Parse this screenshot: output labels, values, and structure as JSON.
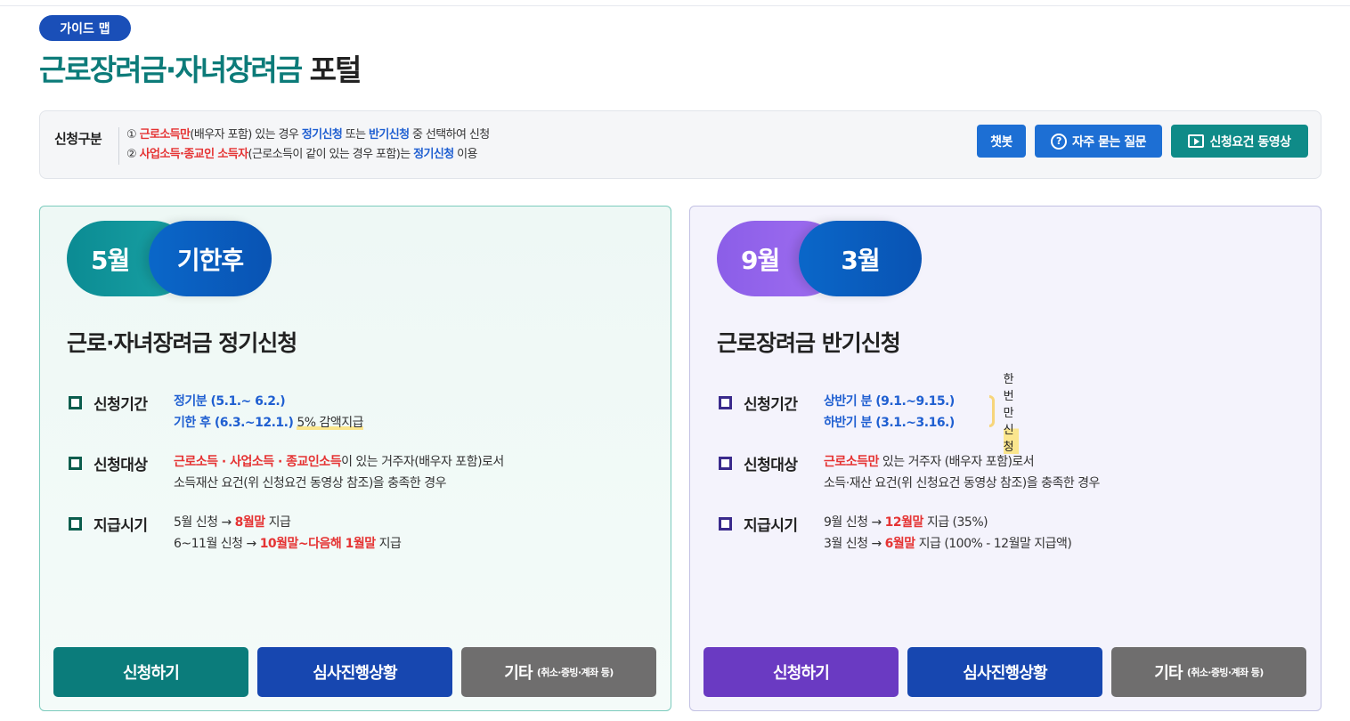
{
  "header": {
    "badge": "가이드 맵",
    "title_main": "근로장려금·자녀장려금",
    "title_sub": "포털"
  },
  "notice": {
    "label": "신청구분",
    "line1": [
      {
        "t": "① ",
        "s": ""
      },
      {
        "t": "근로소득만",
        "s": "red"
      },
      {
        "t": "(배우자 포함) 있는 경우 ",
        "s": ""
      },
      {
        "t": "정기신청",
        "s": "blue"
      },
      {
        "t": " 또는 ",
        "s": ""
      },
      {
        "t": "반기신청",
        "s": "blue"
      },
      {
        "t": " 중 선택하여 신청",
        "s": ""
      }
    ],
    "line2": [
      {
        "t": "② ",
        "s": ""
      },
      {
        "t": "사업소득·종교인 소득자",
        "s": "red"
      },
      {
        "t": "(근로소득이 같이 있는 경우 포함)는 ",
        "s": ""
      },
      {
        "t": "정기신청",
        "s": "blue"
      },
      {
        "t": " 이용",
        "s": ""
      }
    ],
    "buttons": {
      "chatbot": "챗봇",
      "faq": "자주 묻는 질문",
      "video": "신청요건 동영상"
    }
  },
  "cards": [
    {
      "pill_a": "5월",
      "pill_b": "기한후",
      "title": "근로·자녀장려금 정기신청",
      "rows": [
        {
          "label": "신청기간",
          "lines": [
            [
              {
                "t": "정기분 (5.1.~ 6.2.)",
                "s": "blue"
              }
            ],
            [
              {
                "t": "기한 후 (6.3.~12.1.)",
                "s": "blue"
              },
              {
                "t": "  ",
                "s": ""
              },
              {
                "t": "5% 감액지급",
                "s": "hl"
              }
            ]
          ]
        },
        {
          "label": "신청대상",
          "lines": [
            [
              {
                "t": "근로소득 · 사업소득 · 종교인소득",
                "s": "red"
              },
              {
                "t": "이 있는 거주자(배우자 포함)로서",
                "s": ""
              }
            ],
            [
              {
                "t": "소득재산 요건(위 신청요건 동영상 참조)을 충족한 경우",
                "s": ""
              }
            ]
          ]
        },
        {
          "label": "지급시기",
          "lines": [
            [
              {
                "t": "5월 신청 → ",
                "s": ""
              },
              {
                "t": "8월말",
                "s": "red"
              },
              {
                "t": " 지급",
                "s": ""
              }
            ],
            [
              {
                "t": "6~11월 신청 → ",
                "s": ""
              },
              {
                "t": "10월말~다음해 1월말",
                "s": "red"
              },
              {
                "t": " 지급",
                "s": ""
              }
            ]
          ]
        }
      ],
      "buttons": {
        "apply": "신청하기",
        "status": "심사진행상황",
        "etc": "기타",
        "etc_sub": "(취소·증빙·계좌 등)"
      }
    },
    {
      "pill_a": "9월",
      "pill_b": "3월",
      "title": "근로장려금 반기신청",
      "rows": [
        {
          "label": "신청기간",
          "lines": [
            [
              {
                "t": "상반기 분 (9.1.~9.15.)",
                "s": "blue"
              }
            ],
            [
              {
                "t": "하반기 분 (3.1.~3.16.)",
                "s": "blue"
              }
            ]
          ],
          "note": "한번만 신청"
        },
        {
          "label": "신청대상",
          "lines": [
            [
              {
                "t": "근로소득만",
                "s": "red"
              },
              {
                "t": " 있는 거주자 (배우자 포함)로서",
                "s": ""
              }
            ],
            [
              {
                "t": "소득·재산 요건(위 신청요건 동영상 참조)을 충족한 경우",
                "s": ""
              }
            ]
          ]
        },
        {
          "label": "지급시기",
          "lines": [
            [
              {
                "t": "9월 신청 → ",
                "s": ""
              },
              {
                "t": "12월말",
                "s": "red"
              },
              {
                "t": " 지급 (35%)",
                "s": ""
              }
            ],
            [
              {
                "t": "3월 신청 → ",
                "s": ""
              },
              {
                "t": "6월말",
                "s": "red"
              },
              {
                "t": " 지급 (100% - 12월말 지급액)",
                "s": ""
              }
            ]
          ]
        }
      ],
      "buttons": {
        "apply": "신청하기",
        "status": "심사진행상황",
        "etc": "기타",
        "etc_sub": "(취소·증빙·계좌 등)"
      }
    }
  ],
  "colors": {
    "teal": "#0b7c7b",
    "navy": "#1747b0",
    "purple": "#6a3ac2",
    "red": "#e53333",
    "blue": "#1f5fd1"
  }
}
